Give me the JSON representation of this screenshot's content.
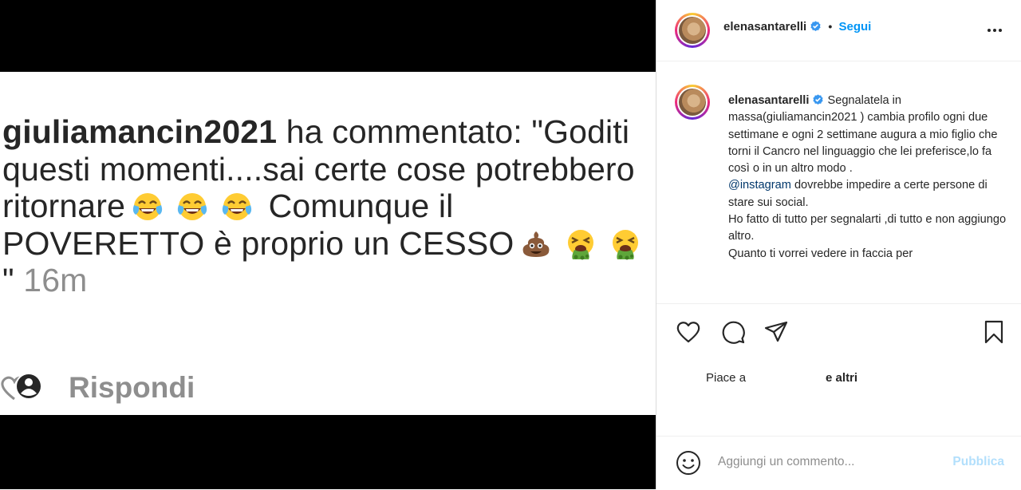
{
  "media": {
    "comment": {
      "username": "giuliamancin2021",
      "text_1": " ha commentato: \"Goditi questi momenti....sai certe cose potrebbero ritornare",
      "text_2": " Comunque il POVERETTO è proprio un CESSO",
      "text_3": " \"",
      "time": "16m",
      "emojis_1": [
        "face-with-tears-of-joy-icon",
        "face-with-tears-of-joy-icon",
        "face-with-tears-of-joy-icon"
      ],
      "emojis_2": [
        "pile-of-poo-icon",
        "face-vomiting-icon",
        "face-vomiting-icon"
      ]
    },
    "reply_label": "Rispondi"
  },
  "header": {
    "username": "elenasantarelli",
    "separator": "•",
    "follow_label": "Segui"
  },
  "caption": {
    "username": "elenasantarelli",
    "text_1": "Segnalatela in massa(giuliamancin2021 ) cambia profilo ogni due settimane e ogni 2 settimane augura a mio figlio che torni il Cancro nel linguaggio che lei preferisce,lo fa così o in un altro modo .",
    "mention": "@instagram",
    "text_2": " dovrebbe impedire a certe persone di stare sui social.",
    "text_3": "Ho fatto di tutto per segnalarti ,di tutto e non aggiungo altro.",
    "text_4": "Quanto ti vorrei vedere in faccia per"
  },
  "likes": {
    "prefix": "Piace a",
    "suffix": "e altri"
  },
  "add_comment": {
    "placeholder": "Aggiungi un commento...",
    "publish_label": "Pubblica"
  },
  "colors": {
    "link": "#0095f6",
    "publish_disabled": "#b2dffc",
    "muted": "#8e8e8e",
    "text": "#262626"
  }
}
